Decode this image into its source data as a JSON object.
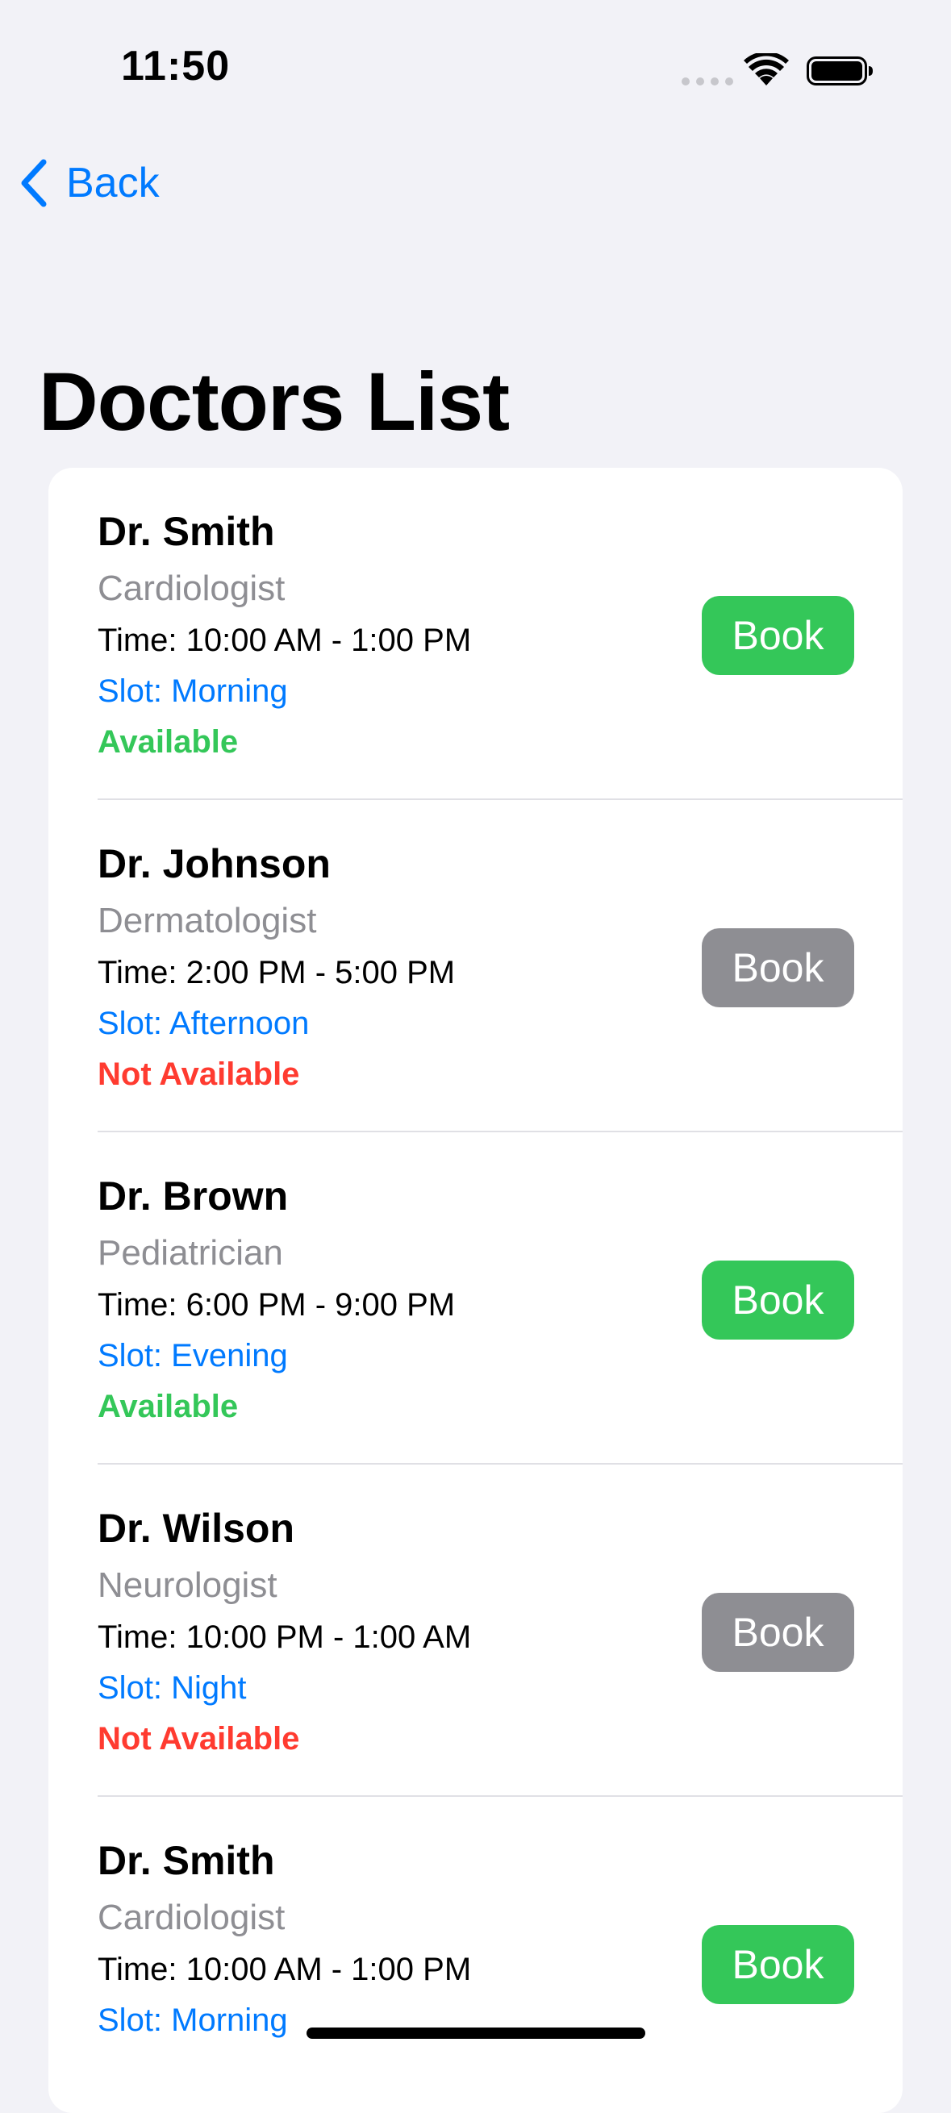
{
  "status_bar": {
    "time": "11:50"
  },
  "nav": {
    "back_label": "Back"
  },
  "page": {
    "title": "Doctors List"
  },
  "colors": {
    "accent": "#007aff",
    "available": "#34c759",
    "not_available": "#ff3b30",
    "book_enabled": "#34c759",
    "book_disabled": "#8e8e93"
  },
  "doctors": [
    {
      "name": "Dr. Smith",
      "specialty": "Cardiologist",
      "time": "Time: 10:00 AM - 1:00 PM",
      "slot": "Slot: Morning",
      "status": "Available",
      "available": true,
      "book_label": "Book"
    },
    {
      "name": "Dr. Johnson",
      "specialty": "Dermatologist",
      "time": "Time: 2:00 PM - 5:00 PM",
      "slot": "Slot: Afternoon",
      "status": "Not Available",
      "available": false,
      "book_label": "Book"
    },
    {
      "name": "Dr. Brown",
      "specialty": "Pediatrician",
      "time": "Time: 6:00 PM - 9:00 PM",
      "slot": "Slot: Evening",
      "status": "Available",
      "available": true,
      "book_label": "Book"
    },
    {
      "name": "Dr. Wilson",
      "specialty": "Neurologist",
      "time": "Time: 10:00 PM - 1:00 AM",
      "slot": "Slot: Night",
      "status": "Not Available",
      "available": false,
      "book_label": "Book"
    },
    {
      "name": "Dr. Smith",
      "specialty": "Cardiologist",
      "time": "Time: 10:00 AM - 1:00 PM",
      "slot": "Slot: Morning",
      "status": "",
      "available": true,
      "book_label": "Book"
    }
  ]
}
